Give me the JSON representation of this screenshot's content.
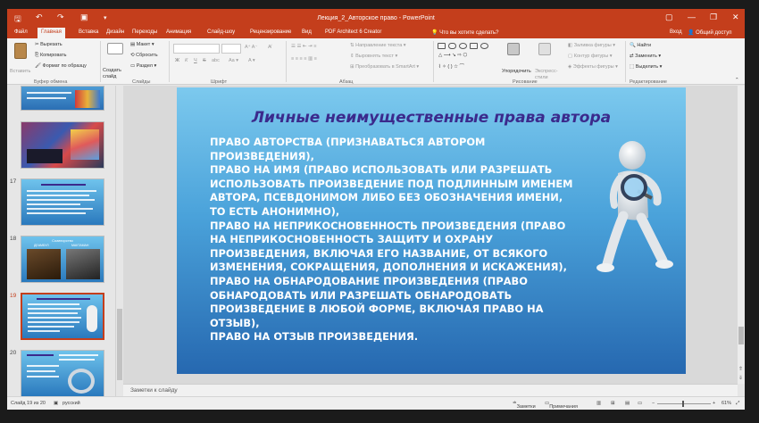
{
  "window": {
    "title": "Лекция_2_Авторское право - PowerPoint",
    "controls": [
      "▢",
      "—",
      "❐",
      "✕"
    ]
  },
  "tabs": [
    "Файл",
    "Главная",
    "Вставка",
    "Дизайн",
    "Переходы",
    "Анимация",
    "Слайд-шоу",
    "Рецензирование",
    "Вид",
    "PDF Architect 6 Creator"
  ],
  "active_tab": "Главная",
  "tell_me": "Что вы хотите сделать?",
  "account": {
    "signin": "Вход",
    "share": "Общий доступ"
  },
  "ribbon": {
    "clipboard": {
      "paste": "Вставить",
      "cut": "Вырезать",
      "copy": "Копировать",
      "format": "Формат по образцу",
      "label": "Буфер обмена"
    },
    "slides": {
      "new_slide": "Создать слайд",
      "layout": "Макет",
      "reset": "Сбросить",
      "section": "Раздел",
      "label": "Слайды"
    },
    "font": {
      "bold": "Ж",
      "italic": "К",
      "underline": "Ч",
      "strike": "S",
      "spacing": "abc",
      "label": "Шрифт"
    },
    "paragraph": {
      "text_dir": "Направление текста",
      "align_text": "Выровнять текст",
      "smartart": "Преобразовать в SmartArt",
      "label": "Абзац"
    },
    "drawing": {
      "arrange": "Упорядочить",
      "quick_styles": "Экспресс-стили",
      "fill": "Заливка фигуры",
      "outline": "Контур фигуры",
      "effects": "Эффекты фигуры",
      "label": "Рисование"
    },
    "editing": {
      "find": "Найти",
      "replace": "Заменить",
      "select": "Выделить",
      "label": "Редактирование"
    }
  },
  "thumbnails": [
    {
      "num": "",
      "style": "partial"
    },
    {
      "num": "",
      "style": "collage"
    },
    {
      "num": "17",
      "style": "text"
    },
    {
      "num": "18",
      "style": "photo",
      "caption": "Соавторство",
      "left": "ДЕАМБУЛ",
      "right": "МАКТАМАН"
    },
    {
      "num": "19",
      "style": "text",
      "selected": true
    },
    {
      "num": "20",
      "style": "text"
    }
  ],
  "slide": {
    "title": "Личные неимущественные права автора",
    "lines": [
      "ПРАВО АВТОРСТВА (ПРИЗНАВАТЬСЯ АВТОРОМ",
      "ПРОИЗВЕДЕНИЯ),",
      "ПРАВО НА ИМЯ (ПРАВО ИСПОЛЬЗОВАТЬ ИЛИ РАЗРЕШАТЬ",
      "ИСПОЛЬЗОВАТЬ ПРОИЗВЕДЕНИЕ ПОД ПОДЛИННЫМ ИМЕНЕМ",
      "АВТОРА, ПСЕВДОНИМОМ ЛИБО БЕЗ ОБОЗНАЧЕНИЯ ИМЕНИ,",
      "ТО ЕСТЬ АНОНИМНО),",
      "ПРАВО НА НЕПРИКОСНОВЕННОСТЬ ПРОИЗВЕДЕНИЯ (ПРАВО",
      "НА НЕПРИКОСНОВЕННОСТЬ ЗАЩИТУ И ОХРАНУ",
      "ПРОИЗВЕДЕНИЯ, ВКЛЮЧАЯ ЕГО НАЗВАНИЕ, ОТ ВСЯКОГО",
      "ИЗМЕНЕНИЯ, СОКРАЩЕНИЯ, ДОПОЛНЕНИЯ И ИСКАЖЕНИЯ),",
      "ПРАВО НА ОБНАРОДОВАНИЕ ПРОИЗВЕДЕНИЯ (ПРАВО",
      "ОБНАРОДОВАТЬ ИЛИ РАЗРЕШАТЬ ОБНАРОДОВАТЬ",
      "ПРОИЗВЕДЕНИЕ В ЛЮБОЙ ФОРМЕ, ВКЛЮЧАЯ ПРАВО НА",
      "ОТЗЫВ),",
      "ПРАВО НА ОТЗЫВ ПРОИЗВЕДЕНИЯ."
    ],
    "title_color": "#3b2a8c"
  },
  "notes_placeholder": "Заметки к слайду",
  "status": {
    "slide_info": "Слайд 19 из 20",
    "language": "русский",
    "notes": "Заметки",
    "comments": "Примечания",
    "zoom": "61%"
  },
  "colors": {
    "accent": "#c43e1c"
  }
}
